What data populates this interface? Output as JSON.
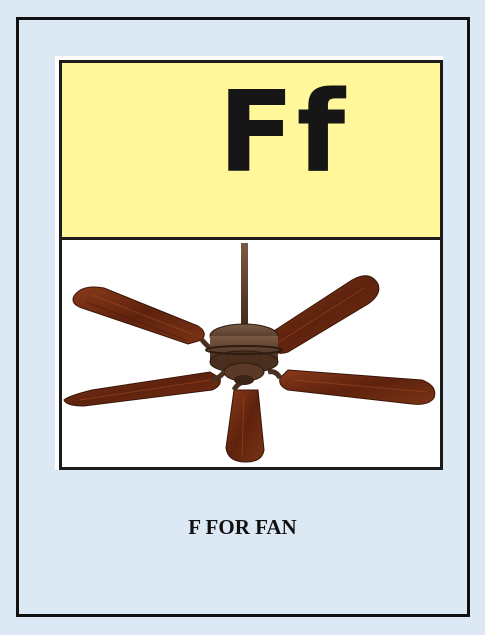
{
  "flashcard": {
    "letter": "Ff",
    "caption": "F FOR FAN",
    "image_subject": "ceiling-fan",
    "colors": {
      "background": "#dde8f5",
      "letter_box": "#fff79a",
      "blade_wood": "#6b2a12",
      "fan_body": "#5a3a26"
    }
  }
}
